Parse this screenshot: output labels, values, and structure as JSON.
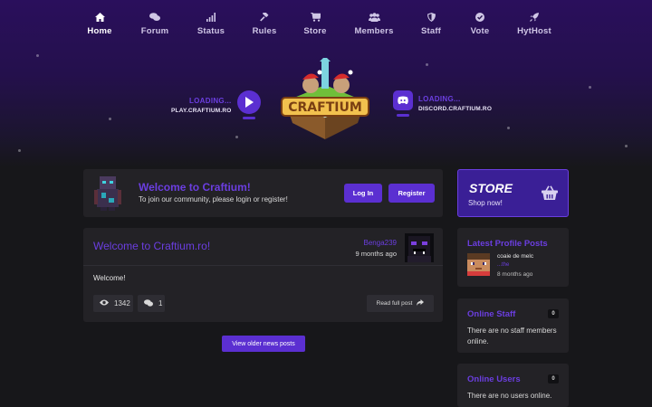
{
  "nav": {
    "items": [
      {
        "label": "Home",
        "icon": "home-icon",
        "active": true
      },
      {
        "label": "Forum",
        "icon": "comments-icon"
      },
      {
        "label": "Status",
        "icon": "signal-icon"
      },
      {
        "label": "Rules",
        "icon": "gavel-icon"
      },
      {
        "label": "Store",
        "icon": "cart-icon"
      },
      {
        "label": "Members",
        "icon": "users-icon"
      },
      {
        "label": "Staff",
        "icon": "shield-icon"
      },
      {
        "label": "Vote",
        "icon": "check-circle-icon"
      },
      {
        "label": "HytHost",
        "icon": "rocket-icon"
      }
    ]
  },
  "hero": {
    "left_loading": "LOADING...",
    "left_address": "PLAY.CRAFTIUM.RO",
    "right_loading": "LOADING...",
    "right_address": "DISCORD.CRAFTIUM.RO",
    "logo_text": "CRAFTIUM"
  },
  "welcome": {
    "title": "Welcome to Craftium!",
    "subtitle": "To join our community, please login or register!",
    "login_label": "Log In",
    "register_label": "Register"
  },
  "store": {
    "title": "STORE",
    "subtitle": "Shop now!"
  },
  "news": {
    "title": "Welcome to Craftium.ro!",
    "author": "Benga239",
    "time": "9 months ago",
    "body": "Welcome!",
    "views": "1342",
    "replies": "1",
    "read_label": "Read full post"
  },
  "older_news_label": "View older news posts",
  "latest_profile_posts": {
    "title": "Latest Profile Posts",
    "author": "coaie de melc",
    "link": "...the",
    "time": "8 months ago"
  },
  "online_staff": {
    "title": "Online Staff",
    "count": "0",
    "text": "There are no staff members online."
  },
  "online_users": {
    "title": "Online Users",
    "count": "0",
    "text": "There are no users online."
  },
  "colors": {
    "accent": "#5b2fd1",
    "accent_text": "#6b3ee0",
    "card": "#232226",
    "background": "#17171a"
  }
}
